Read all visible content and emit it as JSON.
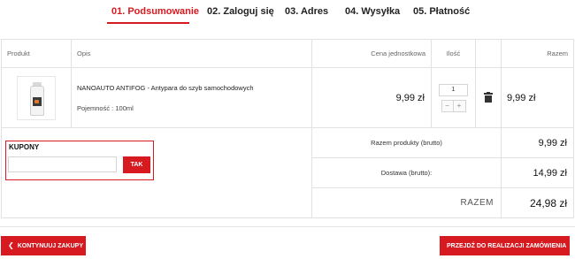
{
  "steps": [
    {
      "label": "01. Podsumowanie",
      "active": true
    },
    {
      "label": "02. Zaloguj się",
      "active": false
    },
    {
      "label": "03. Adres",
      "active": false
    },
    {
      "label": "04. Wysyłka",
      "active": false
    },
    {
      "label": "05. Płatność",
      "active": false
    }
  ],
  "table": {
    "headers": {
      "product": "Produkt",
      "description": "Opis",
      "unit_price": "Cena jednostkowa",
      "quantity": "Ilość",
      "total": "Razem"
    }
  },
  "item": {
    "name": "NANOAUTO ANTIFOG - Antypara do szyb samochodowych",
    "option": "Pojemność : 100ml",
    "unit_price": "9,99 zł",
    "quantity": "1",
    "qty_minus": "−",
    "qty_plus": "+",
    "total": "9,99 zł",
    "image_icon": "spray-bottle-icon",
    "delete_icon": "trash-icon"
  },
  "coupon": {
    "title": "KUPONY",
    "input_value": "",
    "button_label": "TAK"
  },
  "summary": {
    "products_label": "Razem produkty (brutto)",
    "products_value": "9,99 zł",
    "shipping_label": "Dostawa (brutto):",
    "shipping_value": "14,99 zł",
    "total_label": "RAZEM",
    "total_value": "24,98 zł"
  },
  "actions": {
    "back_label": "KONTYNUUJ ZAKUPY",
    "next_label": "PRZEJDŹ DO REALIZACJI ZAMÓWIENIA",
    "back_icon": "chevron-left-icon",
    "next_icon": "chevron-right-icon"
  },
  "colors": {
    "accent": "#d71920",
    "border": "#e2e2e2",
    "text": "#222222"
  }
}
